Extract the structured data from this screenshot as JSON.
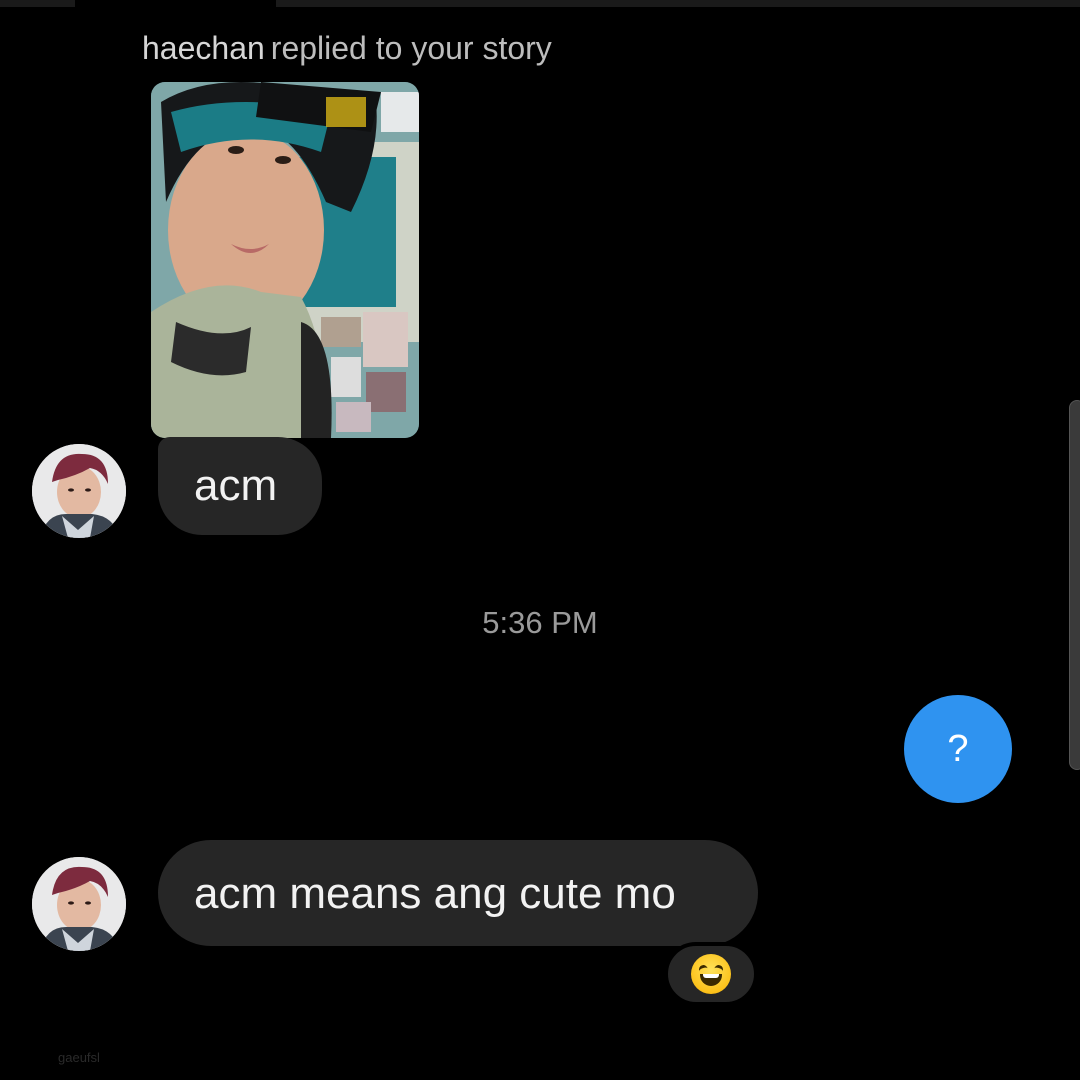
{
  "story_reply": {
    "username": "haechan",
    "action_text": "replied to your story"
  },
  "messages": [
    {
      "direction": "incoming",
      "text": "acm"
    },
    {
      "direction": "outgoing",
      "text": "?"
    },
    {
      "direction": "incoming",
      "text": "acm means ang cute mo"
    }
  ],
  "timestamp": "5:36 PM",
  "reaction": {
    "emoji_name": "grinning-squinting-face-icon"
  },
  "watermark": "gaeufsl",
  "colors": {
    "background": "#000000",
    "incoming_bubble": "#262626",
    "outgoing_bubble": "#2f93f0",
    "secondary_text": "#9a9a9a"
  }
}
